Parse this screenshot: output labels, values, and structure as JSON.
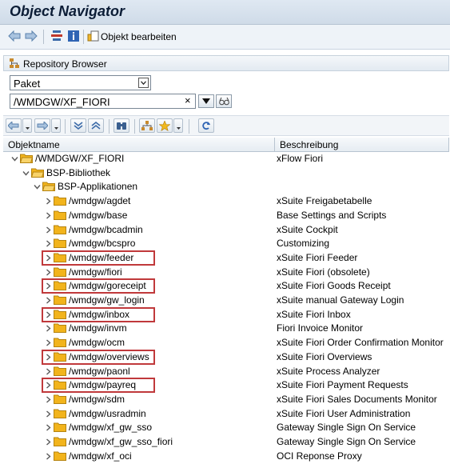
{
  "window": {
    "title": "Object Navigator"
  },
  "toolbar": {
    "edit_object_label": "Objekt bearbeiten"
  },
  "repository": {
    "section_title": "Repository Browser",
    "type_select_value": "Paket",
    "package_input_value": "/WMDGW/XF_FIORI",
    "clear_glyph": "×"
  },
  "columns": {
    "name": "Objektname",
    "description": "Beschreibung"
  },
  "tree": [
    {
      "label": "/WMDGW/XF_FIORI",
      "desc": "xFlow Fiori",
      "level": 0,
      "expanded": true,
      "highlight": false
    },
    {
      "label": "BSP-Bibliothek",
      "desc": "",
      "level": 1,
      "expanded": true,
      "highlight": false
    },
    {
      "label": "BSP-Applikationen",
      "desc": "",
      "level": 2,
      "expanded": true,
      "highlight": false
    },
    {
      "label": "/wmdgw/agdet",
      "desc": "xSuite Freigabetabelle",
      "level": 3,
      "expanded": false,
      "highlight": false
    },
    {
      "label": "/wmdgw/base",
      "desc": "Base Settings and Scripts",
      "level": 3,
      "expanded": false,
      "highlight": false
    },
    {
      "label": "/wmdgw/bcadmin",
      "desc": "xSuite Cockpit",
      "level": 3,
      "expanded": false,
      "highlight": false
    },
    {
      "label": "/wmdgw/bcspro",
      "desc": "Customizing",
      "level": 3,
      "expanded": false,
      "highlight": false
    },
    {
      "label": "/wmdgw/feeder",
      "desc": "xSuite Fiori Feeder",
      "level": 3,
      "expanded": false,
      "highlight": true
    },
    {
      "label": "/wmdgw/fiori",
      "desc": "xSuite Fiori (obsolete)",
      "level": 3,
      "expanded": false,
      "highlight": false
    },
    {
      "label": "/wmdgw/goreceipt",
      "desc": "xSuite Fiori Goods Receipt",
      "level": 3,
      "expanded": false,
      "highlight": true
    },
    {
      "label": "/wmdgw/gw_login",
      "desc": "xSuite manual Gateway Login",
      "level": 3,
      "expanded": false,
      "highlight": false
    },
    {
      "label": "/wmdgw/inbox",
      "desc": "xSuite Fiori Inbox",
      "level": 3,
      "expanded": false,
      "highlight": true
    },
    {
      "label": "/wmdgw/invm",
      "desc": "Fiori Invoice Monitor",
      "level": 3,
      "expanded": false,
      "highlight": false
    },
    {
      "label": "/wmdgw/ocm",
      "desc": "xSuite Fiori Order Confirmation Monitor",
      "level": 3,
      "expanded": false,
      "highlight": false
    },
    {
      "label": "/wmdgw/overviews",
      "desc": "xSuite Fiori Overviews",
      "level": 3,
      "expanded": false,
      "highlight": true
    },
    {
      "label": "/wmdgw/paonl",
      "desc": "xSuite Process Analyzer",
      "level": 3,
      "expanded": false,
      "highlight": false
    },
    {
      "label": "/wmdgw/payreq",
      "desc": "xSuite Fiori Payment Requests",
      "level": 3,
      "expanded": false,
      "highlight": true
    },
    {
      "label": "/wmdgw/sdm",
      "desc": "xSuite Fiori Sales Documents Monitor",
      "level": 3,
      "expanded": false,
      "highlight": false
    },
    {
      "label": "/wmdgw/usradmin",
      "desc": "xSuite Fiori User Administration",
      "level": 3,
      "expanded": false,
      "highlight": false
    },
    {
      "label": "/wmdgw/xf_gw_sso",
      "desc": "Gateway Single Sign On Service",
      "level": 3,
      "expanded": false,
      "highlight": false
    },
    {
      "label": "/wmdgw/xf_gw_sso_fiori",
      "desc": "Gateway Single Sign On Service",
      "level": 3,
      "expanded": false,
      "highlight": false
    },
    {
      "label": "/wmdgw/xf_oci",
      "desc": "OCI Reponse Proxy",
      "level": 3,
      "expanded": false,
      "highlight": false
    }
  ],
  "colors": {
    "highlight": "#c0393b",
    "folder": "#f2b41c",
    "chevron": "#5a5a5a"
  }
}
